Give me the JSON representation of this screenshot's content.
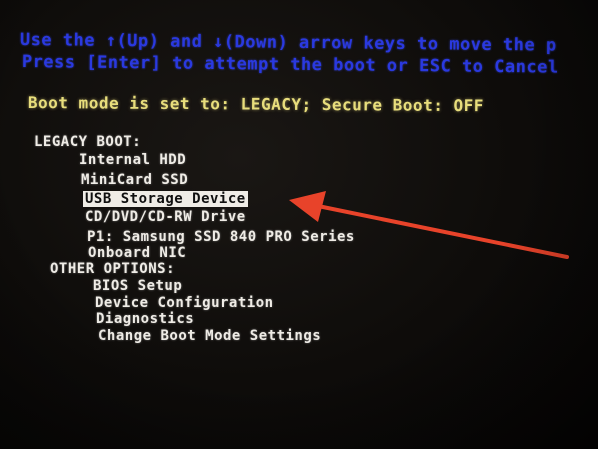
{
  "instructions": {
    "line1": "Use the ↑(Up) and ↓(Down) arrow keys to move the p",
    "line2": "Press [Enter] to attempt the boot or ESC to Cancel"
  },
  "boot_mode": {
    "text": "Boot mode is set to: LEGACY; Secure Boot: OFF"
  },
  "legacy_boot": {
    "heading": "LEGACY BOOT:",
    "items": [
      {
        "label": "Internal HDD",
        "selected": false
      },
      {
        "label": "MiniCard SSD",
        "selected": false
      },
      {
        "label": "USB Storage Device",
        "selected": true
      },
      {
        "label": "CD/DVD/CD-RW Drive",
        "selected": false
      },
      {
        "label": "P1: Samsung SSD 840 PRO Series",
        "selected": false
      },
      {
        "label": "Onboard NIC",
        "selected": false
      }
    ]
  },
  "other_options": {
    "heading": "OTHER OPTIONS:",
    "items": [
      {
        "label": "BIOS Setup"
      },
      {
        "label": "Device Configuration"
      },
      {
        "label": "Diagnostics"
      },
      {
        "label": "Change Boot Mode Settings"
      }
    ]
  },
  "colors": {
    "instruction_text": "#2a39e0",
    "boot_mode_text": "#e8de7c",
    "menu_text": "#efece6",
    "highlight_background": "#efece6",
    "arrow": "#e8432a",
    "background": "#0e0c0a"
  },
  "annotation": {
    "icon": "red-arrow-icon"
  }
}
